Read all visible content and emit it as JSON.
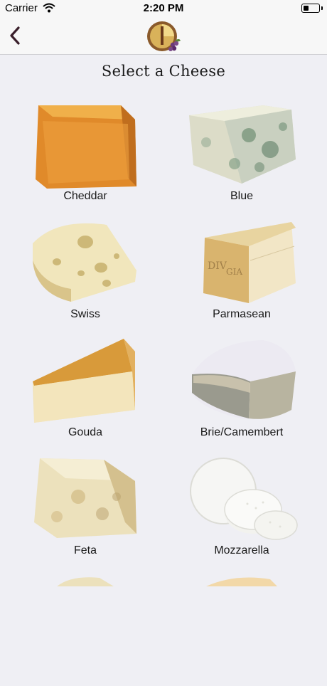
{
  "status": {
    "carrier": "Carrier",
    "time": "2:20 PM"
  },
  "nav": {
    "back_icon": "chevron-left-icon",
    "logo_icon": "cheese-wine-logo"
  },
  "page": {
    "title": "Select a Cheese"
  },
  "cheeses": [
    {
      "label": "Cheddar"
    },
    {
      "label": "Blue"
    },
    {
      "label": "Swiss"
    },
    {
      "label": "Parmasean"
    },
    {
      "label": "Gouda"
    },
    {
      "label": "Brie/Camembert"
    },
    {
      "label": "Feta"
    },
    {
      "label": "Mozzarella"
    }
  ],
  "colors": {
    "accent": "#3a1f2b",
    "background": "#efeff4"
  }
}
